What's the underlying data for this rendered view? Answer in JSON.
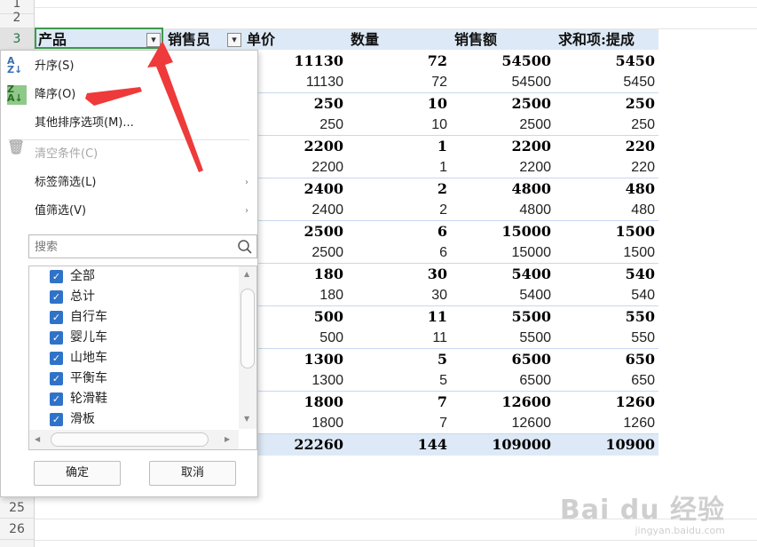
{
  "row_numbers": [
    "1",
    "2",
    "3",
    "25",
    "26"
  ],
  "headers": {
    "product": "产品",
    "salesperson": "销售员",
    "unit_price": "单价",
    "quantity": "数量",
    "sales_amount": "销售额",
    "commission_sum": "求和项:提成"
  },
  "rows": [
    {
      "price": "11130",
      "qty": "72",
      "amount": "54500",
      "commission": "5450",
      "bold": true
    },
    {
      "price": "11130",
      "qty": "72",
      "amount": "54500",
      "commission": "5450",
      "bold": false
    },
    {
      "price": "250",
      "qty": "10",
      "amount": "2500",
      "commission": "250",
      "bold": true
    },
    {
      "price": "250",
      "qty": "10",
      "amount": "2500",
      "commission": "250",
      "bold": false
    },
    {
      "price": "2200",
      "qty": "1",
      "amount": "2200",
      "commission": "220",
      "bold": true
    },
    {
      "price": "2200",
      "qty": "1",
      "amount": "2200",
      "commission": "220",
      "bold": false
    },
    {
      "price": "2400",
      "qty": "2",
      "amount": "4800",
      "commission": "480",
      "bold": true
    },
    {
      "price": "2400",
      "qty": "2",
      "amount": "4800",
      "commission": "480",
      "bold": false
    },
    {
      "price": "2500",
      "qty": "6",
      "amount": "15000",
      "commission": "1500",
      "bold": true
    },
    {
      "price": "2500",
      "qty": "6",
      "amount": "15000",
      "commission": "1500",
      "bold": false
    },
    {
      "price": "180",
      "qty": "30",
      "amount": "5400",
      "commission": "540",
      "bold": true
    },
    {
      "price": "180",
      "qty": "30",
      "amount": "5400",
      "commission": "540",
      "bold": false
    },
    {
      "price": "500",
      "qty": "11",
      "amount": "5500",
      "commission": "550",
      "bold": true
    },
    {
      "price": "500",
      "qty": "11",
      "amount": "5500",
      "commission": "550",
      "bold": false
    },
    {
      "price": "1300",
      "qty": "5",
      "amount": "6500",
      "commission": "650",
      "bold": true
    },
    {
      "price": "1300",
      "qty": "5",
      "amount": "6500",
      "commission": "650",
      "bold": false
    },
    {
      "price": "1800",
      "qty": "7",
      "amount": "12600",
      "commission": "1260",
      "bold": true
    },
    {
      "price": "1800",
      "qty": "7",
      "amount": "12600",
      "commission": "1260",
      "bold": false
    }
  ],
  "total": {
    "price": "22260",
    "qty": "144",
    "amount": "109000",
    "commission": "10900"
  },
  "menu": {
    "sort_asc": "升序(S)",
    "sort_desc": "降序(O)",
    "more_sort": "其他排序选项(M)...",
    "clear_filter": "清空条件(C)",
    "label_filter": "标签筛选(L)",
    "value_filter": "值筛选(V)",
    "submenu_arrow": "›"
  },
  "search": {
    "placeholder": "搜索"
  },
  "filter_items": [
    {
      "label": "全部",
      "checked": true
    },
    {
      "label": "总计",
      "checked": true
    },
    {
      "label": "自行车",
      "checked": true
    },
    {
      "label": "婴儿车",
      "checked": true
    },
    {
      "label": "山地车",
      "checked": true
    },
    {
      "label": "平衡车",
      "checked": true
    },
    {
      "label": "轮滑鞋",
      "checked": true
    },
    {
      "label": "滑板",
      "checked": true
    }
  ],
  "buttons": {
    "ok": "确定",
    "cancel": "取消"
  },
  "watermark": {
    "logo": "Bai du 经验",
    "url": "jingyan.baidu.com"
  },
  "colors": {
    "accent": "#2f73c9",
    "header_bg": "#dde9f6",
    "arrow": "#ee3a3a",
    "selection": "#3d9a4a"
  },
  "icons": [
    "sort-ascending-icon",
    "sort-descending-icon",
    "trash-icon",
    "search-icon",
    "checkbox-checked-icon",
    "filter-dropdown-icon"
  ]
}
